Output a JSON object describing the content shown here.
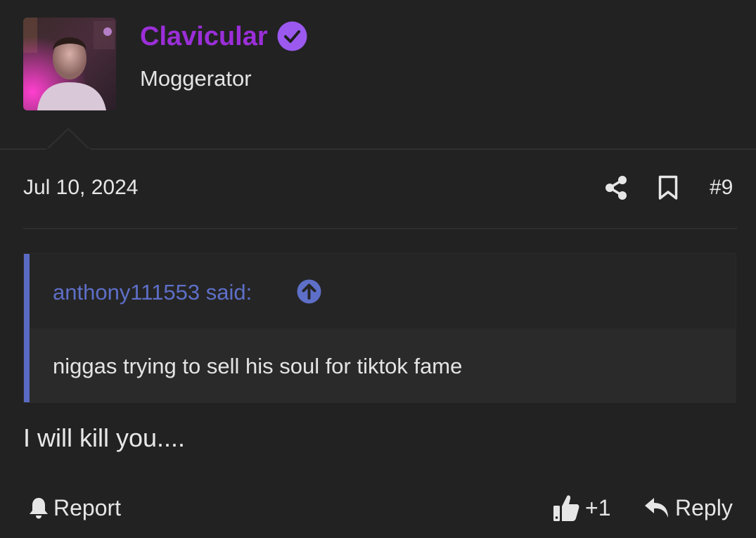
{
  "user": {
    "name": "Clavicular",
    "title": "Moggerator",
    "verified": true,
    "name_color": "#9b2fd9",
    "badge_color": "#9b59f0"
  },
  "post": {
    "date": "Jul 10, 2024",
    "number": "#9",
    "message": "I will kill you...."
  },
  "quote": {
    "author_line": "anthony111553 said:",
    "text": "niggas trying to sell his soul for tiktok fame",
    "accent_color": "#5a6ac4"
  },
  "actions": {
    "report_label": "Report",
    "like_count": "+1",
    "reply_label": "Reply",
    "share_icon": "share-icon",
    "bookmark_icon": "bookmark-icon",
    "report_icon": "bell-icon",
    "like_icon": "thumbs-up-icon",
    "reply_icon": "reply-arrow-icon"
  },
  "colors": {
    "background": "#222222",
    "text": "#e6e6e6"
  }
}
